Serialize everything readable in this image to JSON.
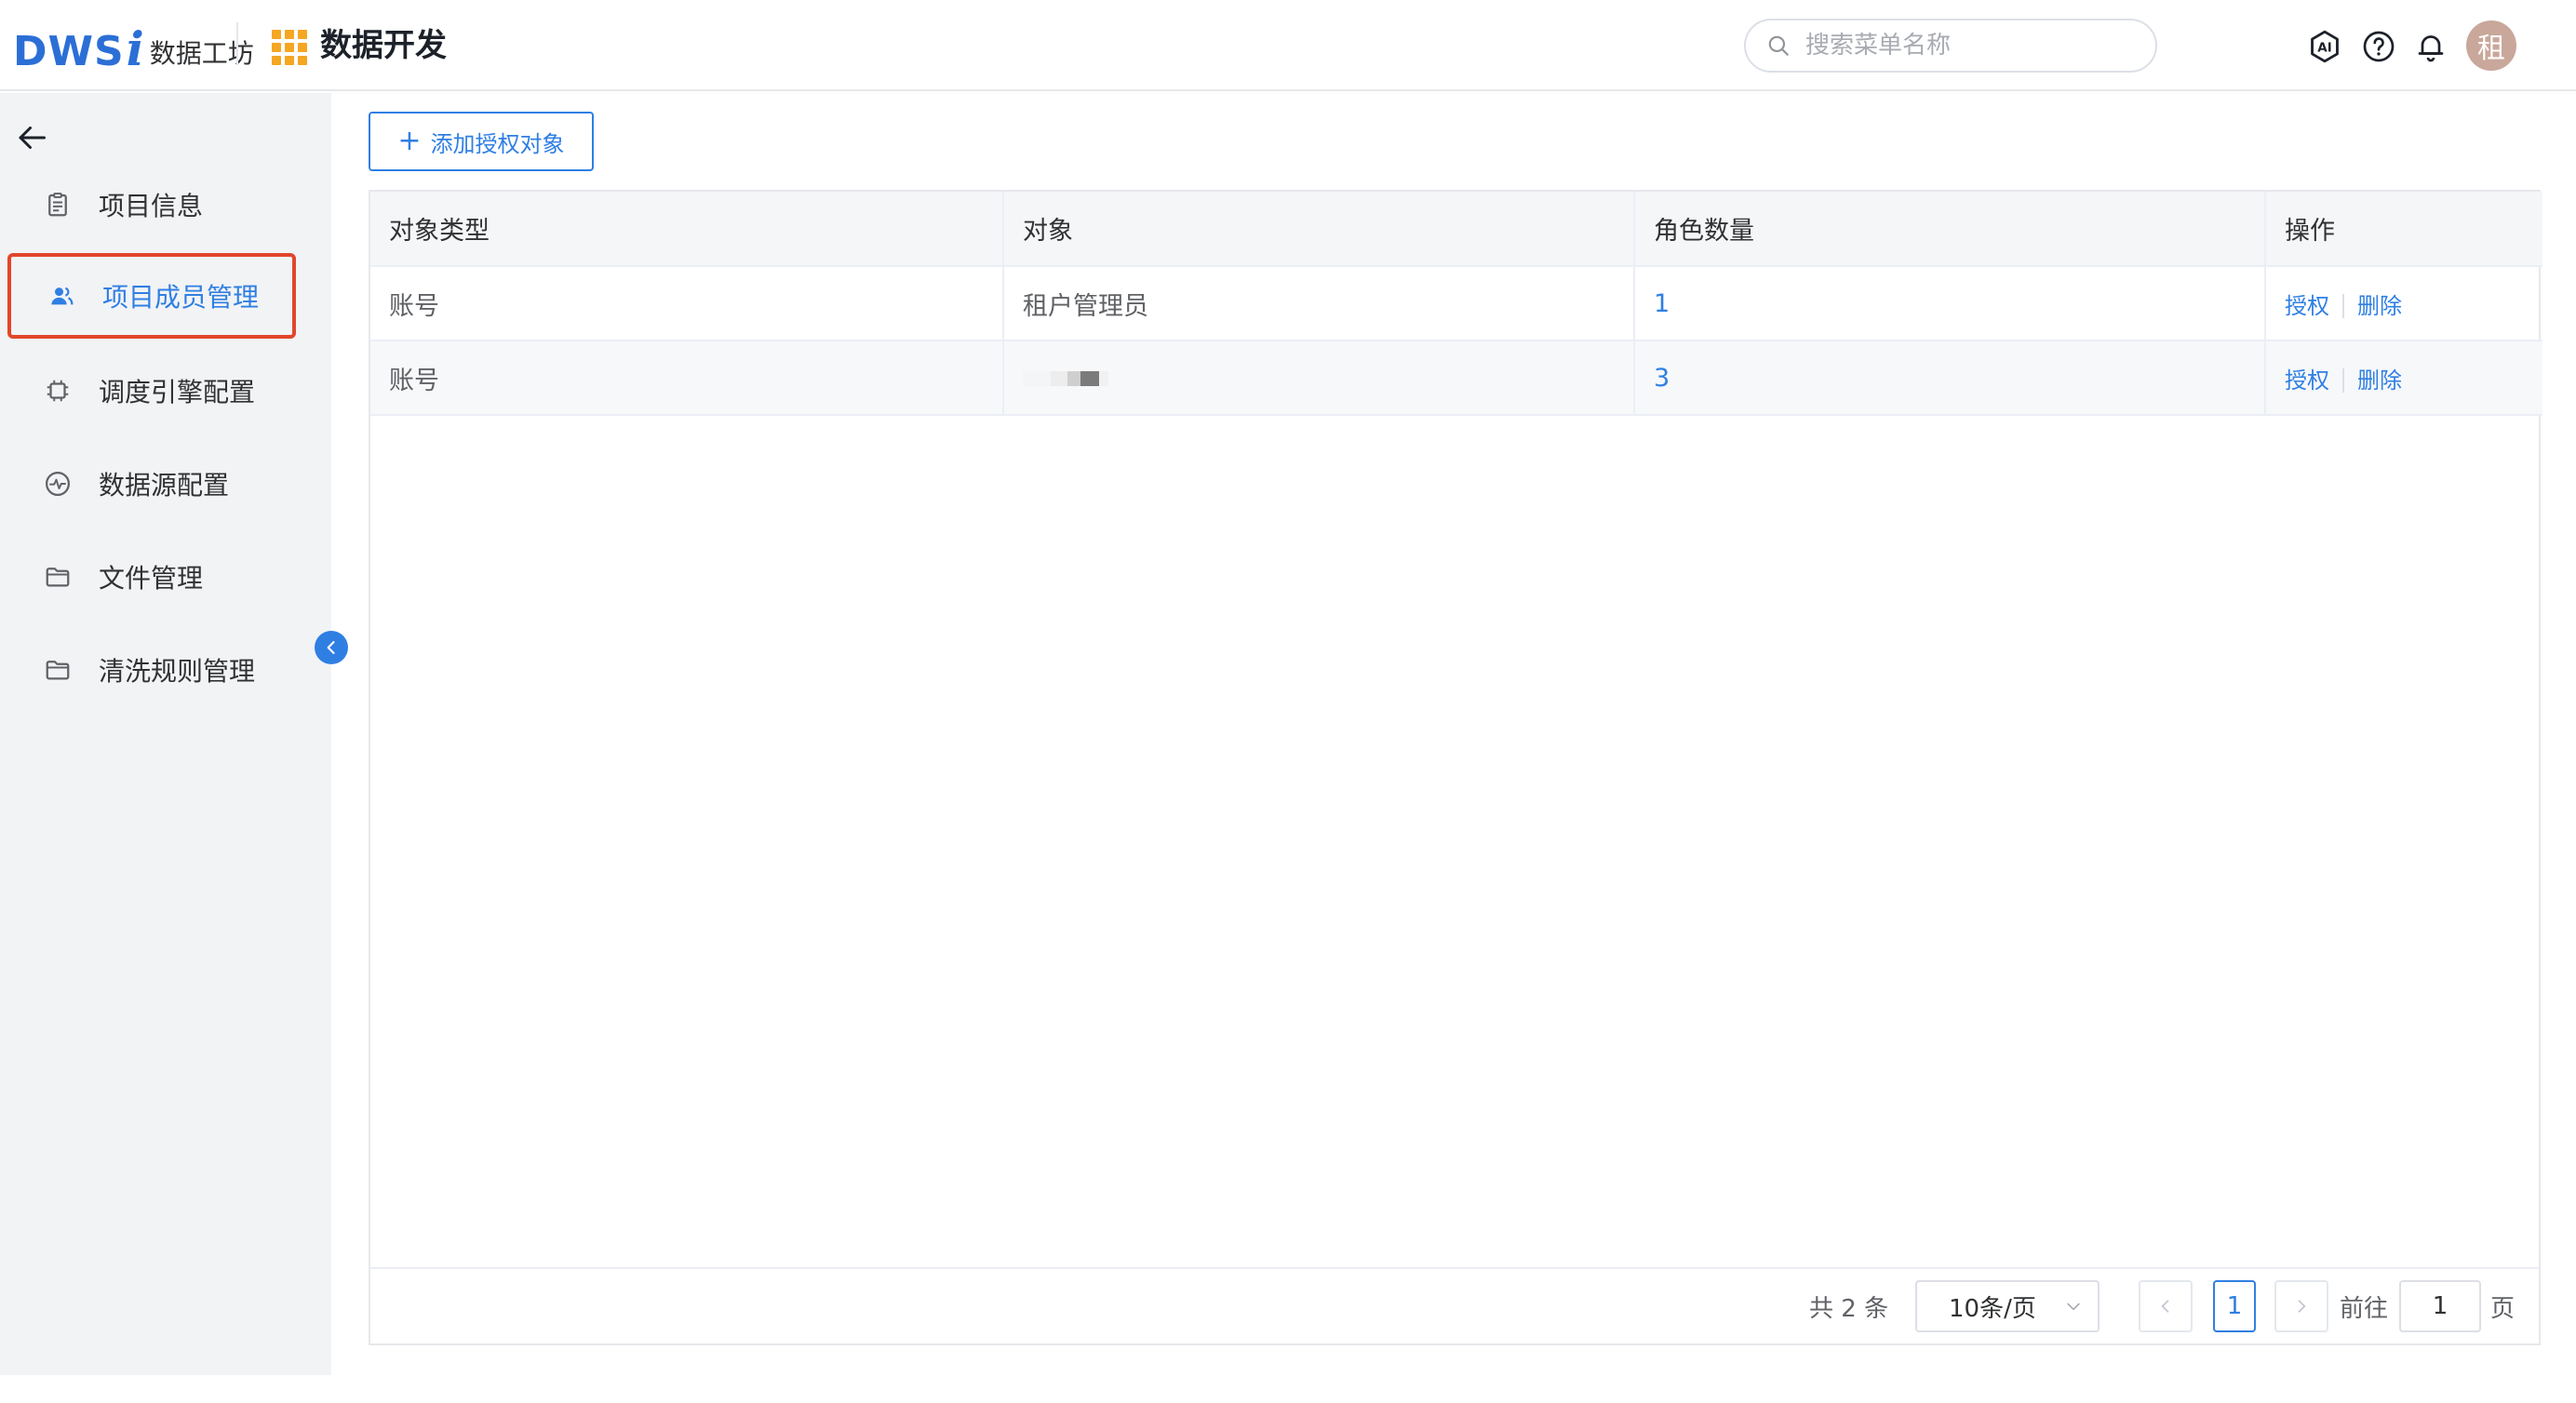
{
  "header": {
    "logo_brand": "DWS",
    "logo_i": "i",
    "logo_text": "数据工坊",
    "app_title": "数据开发",
    "search_placeholder": "搜索菜单名称",
    "avatar_text": "租",
    "icons": [
      "ai-icon",
      "help-icon",
      "bell-icon"
    ]
  },
  "sidebar": {
    "items": [
      {
        "label": "项目信息",
        "icon": "clipboard-icon",
        "active": false
      },
      {
        "label": "项目成员管理",
        "icon": "users-icon",
        "active": true
      },
      {
        "label": "调度引擎配置",
        "icon": "chip-icon",
        "active": false
      },
      {
        "label": "数据源配置",
        "icon": "pulse-icon",
        "active": false
      },
      {
        "label": "文件管理",
        "icon": "folder-icon",
        "active": false
      },
      {
        "label": "清洗规则管理",
        "icon": "folder-icon",
        "active": false
      }
    ]
  },
  "toolbar": {
    "add_label": "添加授权对象"
  },
  "table": {
    "columns": [
      "对象类型",
      "对象",
      "角色数量",
      "操作"
    ],
    "rows": [
      {
        "type": "账号",
        "object": "租户管理员",
        "role_count": "1",
        "actions": [
          "授权",
          "删除"
        ]
      },
      {
        "type": "账号",
        "object": "",
        "role_count": "3",
        "actions": [
          "授权",
          "删除"
        ]
      }
    ]
  },
  "pagination": {
    "total": "共 2 条",
    "page_size": "10条/页",
    "current_page": "1",
    "goto_label": "前往",
    "goto_value": "1",
    "page_suffix": "页"
  },
  "colors": {
    "accent": "#2f7fe3",
    "highlight_border": "#e2462b",
    "logo": "#2b6fd6",
    "app_icon": "#f5a623"
  }
}
